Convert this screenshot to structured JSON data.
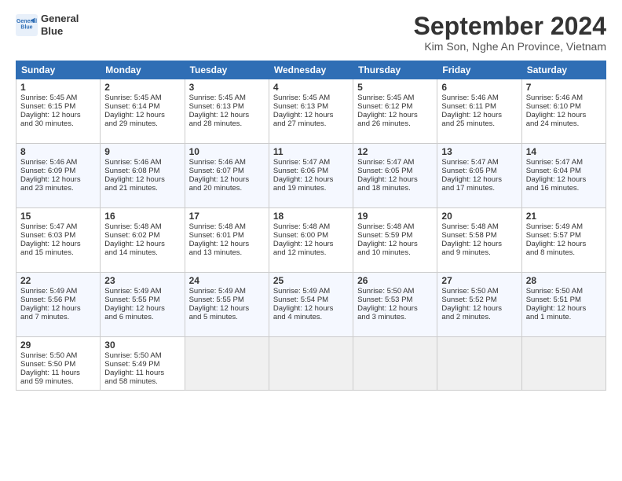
{
  "header": {
    "logo_line1": "General",
    "logo_line2": "Blue",
    "month": "September 2024",
    "location": "Kim Son, Nghe An Province, Vietnam"
  },
  "weekdays": [
    "Sunday",
    "Monday",
    "Tuesday",
    "Wednesday",
    "Thursday",
    "Friday",
    "Saturday"
  ],
  "weeks": [
    [
      {
        "day": "1",
        "lines": [
          "Sunrise: 5:45 AM",
          "Sunset: 6:15 PM",
          "Daylight: 12 hours",
          "and 30 minutes."
        ]
      },
      {
        "day": "2",
        "lines": [
          "Sunrise: 5:45 AM",
          "Sunset: 6:14 PM",
          "Daylight: 12 hours",
          "and 29 minutes."
        ]
      },
      {
        "day": "3",
        "lines": [
          "Sunrise: 5:45 AM",
          "Sunset: 6:13 PM",
          "Daylight: 12 hours",
          "and 28 minutes."
        ]
      },
      {
        "day": "4",
        "lines": [
          "Sunrise: 5:45 AM",
          "Sunset: 6:13 PM",
          "Daylight: 12 hours",
          "and 27 minutes."
        ]
      },
      {
        "day": "5",
        "lines": [
          "Sunrise: 5:45 AM",
          "Sunset: 6:12 PM",
          "Daylight: 12 hours",
          "and 26 minutes."
        ]
      },
      {
        "day": "6",
        "lines": [
          "Sunrise: 5:46 AM",
          "Sunset: 6:11 PM",
          "Daylight: 12 hours",
          "and 25 minutes."
        ]
      },
      {
        "day": "7",
        "lines": [
          "Sunrise: 5:46 AM",
          "Sunset: 6:10 PM",
          "Daylight: 12 hours",
          "and 24 minutes."
        ]
      }
    ],
    [
      {
        "day": "8",
        "lines": [
          "Sunrise: 5:46 AM",
          "Sunset: 6:09 PM",
          "Daylight: 12 hours",
          "and 23 minutes."
        ]
      },
      {
        "day": "9",
        "lines": [
          "Sunrise: 5:46 AM",
          "Sunset: 6:08 PM",
          "Daylight: 12 hours",
          "and 21 minutes."
        ]
      },
      {
        "day": "10",
        "lines": [
          "Sunrise: 5:46 AM",
          "Sunset: 6:07 PM",
          "Daylight: 12 hours",
          "and 20 minutes."
        ]
      },
      {
        "day": "11",
        "lines": [
          "Sunrise: 5:47 AM",
          "Sunset: 6:06 PM",
          "Daylight: 12 hours",
          "and 19 minutes."
        ]
      },
      {
        "day": "12",
        "lines": [
          "Sunrise: 5:47 AM",
          "Sunset: 6:05 PM",
          "Daylight: 12 hours",
          "and 18 minutes."
        ]
      },
      {
        "day": "13",
        "lines": [
          "Sunrise: 5:47 AM",
          "Sunset: 6:05 PM",
          "Daylight: 12 hours",
          "and 17 minutes."
        ]
      },
      {
        "day": "14",
        "lines": [
          "Sunrise: 5:47 AM",
          "Sunset: 6:04 PM",
          "Daylight: 12 hours",
          "and 16 minutes."
        ]
      }
    ],
    [
      {
        "day": "15",
        "lines": [
          "Sunrise: 5:47 AM",
          "Sunset: 6:03 PM",
          "Daylight: 12 hours",
          "and 15 minutes."
        ]
      },
      {
        "day": "16",
        "lines": [
          "Sunrise: 5:48 AM",
          "Sunset: 6:02 PM",
          "Daylight: 12 hours",
          "and 14 minutes."
        ]
      },
      {
        "day": "17",
        "lines": [
          "Sunrise: 5:48 AM",
          "Sunset: 6:01 PM",
          "Daylight: 12 hours",
          "and 13 minutes."
        ]
      },
      {
        "day": "18",
        "lines": [
          "Sunrise: 5:48 AM",
          "Sunset: 6:00 PM",
          "Daylight: 12 hours",
          "and 12 minutes."
        ]
      },
      {
        "day": "19",
        "lines": [
          "Sunrise: 5:48 AM",
          "Sunset: 5:59 PM",
          "Daylight: 12 hours",
          "and 10 minutes."
        ]
      },
      {
        "day": "20",
        "lines": [
          "Sunrise: 5:48 AM",
          "Sunset: 5:58 PM",
          "Daylight: 12 hours",
          "and 9 minutes."
        ]
      },
      {
        "day": "21",
        "lines": [
          "Sunrise: 5:49 AM",
          "Sunset: 5:57 PM",
          "Daylight: 12 hours",
          "and 8 minutes."
        ]
      }
    ],
    [
      {
        "day": "22",
        "lines": [
          "Sunrise: 5:49 AM",
          "Sunset: 5:56 PM",
          "Daylight: 12 hours",
          "and 7 minutes."
        ]
      },
      {
        "day": "23",
        "lines": [
          "Sunrise: 5:49 AM",
          "Sunset: 5:55 PM",
          "Daylight: 12 hours",
          "and 6 minutes."
        ]
      },
      {
        "day": "24",
        "lines": [
          "Sunrise: 5:49 AM",
          "Sunset: 5:55 PM",
          "Daylight: 12 hours",
          "and 5 minutes."
        ]
      },
      {
        "day": "25",
        "lines": [
          "Sunrise: 5:49 AM",
          "Sunset: 5:54 PM",
          "Daylight: 12 hours",
          "and 4 minutes."
        ]
      },
      {
        "day": "26",
        "lines": [
          "Sunrise: 5:50 AM",
          "Sunset: 5:53 PM",
          "Daylight: 12 hours",
          "and 3 minutes."
        ]
      },
      {
        "day": "27",
        "lines": [
          "Sunrise: 5:50 AM",
          "Sunset: 5:52 PM",
          "Daylight: 12 hours",
          "and 2 minutes."
        ]
      },
      {
        "day": "28",
        "lines": [
          "Sunrise: 5:50 AM",
          "Sunset: 5:51 PM",
          "Daylight: 12 hours",
          "and 1 minute."
        ]
      }
    ],
    [
      {
        "day": "29",
        "lines": [
          "Sunrise: 5:50 AM",
          "Sunset: 5:50 PM",
          "Daylight: 11 hours",
          "and 59 minutes."
        ]
      },
      {
        "day": "30",
        "lines": [
          "Sunrise: 5:50 AM",
          "Sunset: 5:49 PM",
          "Daylight: 11 hours",
          "and 58 minutes."
        ]
      },
      {
        "day": "",
        "lines": []
      },
      {
        "day": "",
        "lines": []
      },
      {
        "day": "",
        "lines": []
      },
      {
        "day": "",
        "lines": []
      },
      {
        "day": "",
        "lines": []
      }
    ]
  ]
}
